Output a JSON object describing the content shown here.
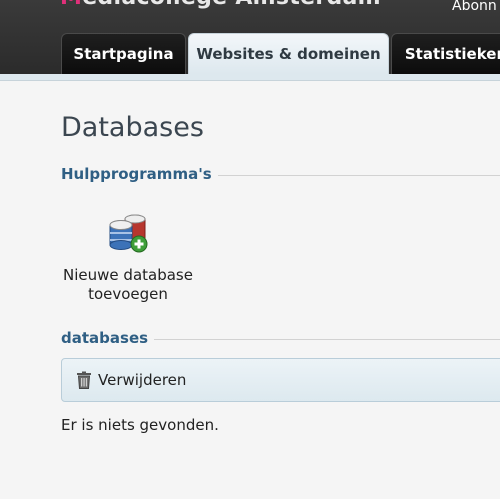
{
  "header": {
    "brand_first_letter": "M",
    "brand_rest": "ediacollege Amsterdam",
    "account_text": "Abonn"
  },
  "tabs": [
    {
      "label": "Startpagina",
      "active": false
    },
    {
      "label": "Websites & domeinen",
      "active": true
    },
    {
      "label": "Statistieken",
      "active": false
    }
  ],
  "page": {
    "title": "Databases",
    "tools_section": {
      "heading": "Hulpprogramma's",
      "items": [
        {
          "label": "Nieuwe database toevoegen",
          "icon": "database-add-icon"
        }
      ]
    },
    "databases_section": {
      "heading": "databases",
      "toolbar": {
        "delete_label": "Verwijderen",
        "delete_icon": "trash-icon"
      },
      "empty_message": "Er is niets gevonden."
    }
  },
  "colors": {
    "top_bar": "#2b2b2b",
    "active_tab": "#dde8ee",
    "section_heading": "#2f5f84",
    "brand_accent": "#e0307a"
  }
}
